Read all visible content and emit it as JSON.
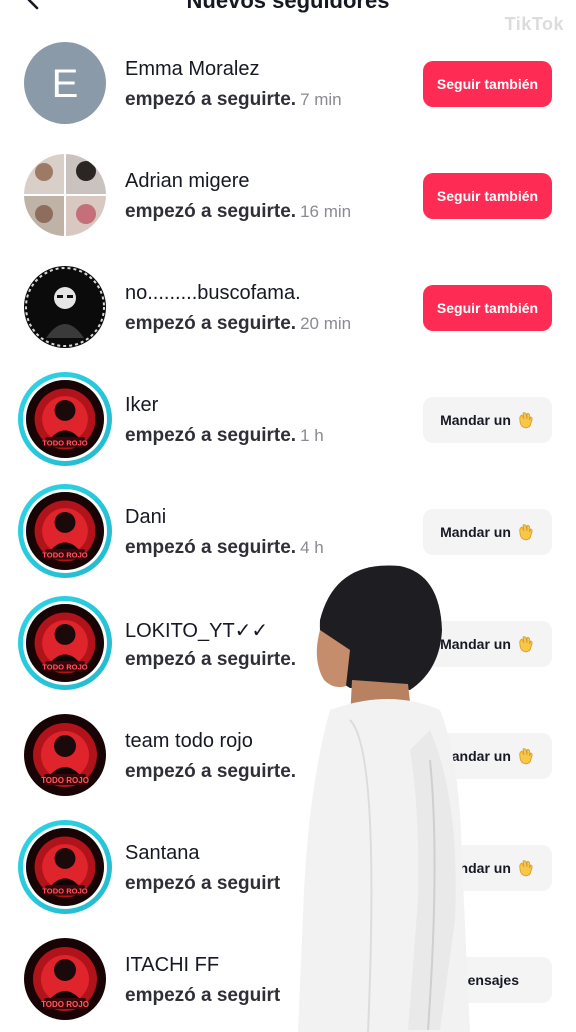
{
  "header": {
    "title": "Nuevos seguidores",
    "watermark": "TikTok"
  },
  "followers": [
    {
      "name": "Emma Moralez",
      "action": "empezó a seguirte.",
      "time": "7 min",
      "button": "Seguir también",
      "type": "follow",
      "avatar": "letter",
      "letter": "E"
    },
    {
      "name": "Adrian migere",
      "action": "empezó a seguirte.",
      "time": "16 min",
      "button": "Seguir también",
      "type": "follow",
      "avatar": "photo-grid"
    },
    {
      "name": "no.........buscofama.",
      "action": "empezó a seguirte.",
      "time": "20 min",
      "button": "Seguir también",
      "type": "follow",
      "avatar": "dark-figure"
    },
    {
      "name": "Iker",
      "action": "empezó a seguirte.",
      "time": "1 h",
      "button": "Mandar un",
      "type": "wave",
      "avatar": "red-team",
      "story": true
    },
    {
      "name": "Dani",
      "action": "empezó a seguirte.",
      "time": "4 h",
      "button": "Mandar un",
      "type": "wave",
      "avatar": "red-team",
      "story": true
    },
    {
      "name": "LOKITO_YT✓✓",
      "action": "empezó a seguirte.",
      "time": "",
      "button": "Mandar un",
      "type": "wave",
      "avatar": "red-team",
      "story": true
    },
    {
      "name": "team todo rojo",
      "action": "empezó a seguirte.",
      "time": "",
      "button": "Mandar un",
      "type": "wave",
      "avatar": "red-team",
      "story": false
    },
    {
      "name": "Santana",
      "action": "empezó a seguirt",
      "time": "",
      "button": "Mandar un",
      "type": "wave",
      "avatar": "red-team",
      "story": true
    },
    {
      "name": "ITACHI FF",
      "action": "empezó a seguirt",
      "time": "",
      "button": "Mensajes",
      "type": "message",
      "avatar": "red-team",
      "story": false
    }
  ],
  "colors": {
    "accent": "#fe2c55",
    "story_ring": "#2fd6e6",
    "secondary_button": "#f4f4f5"
  },
  "icons": {
    "back": "chevron-left-icon",
    "wave": "waving-hand-icon"
  }
}
